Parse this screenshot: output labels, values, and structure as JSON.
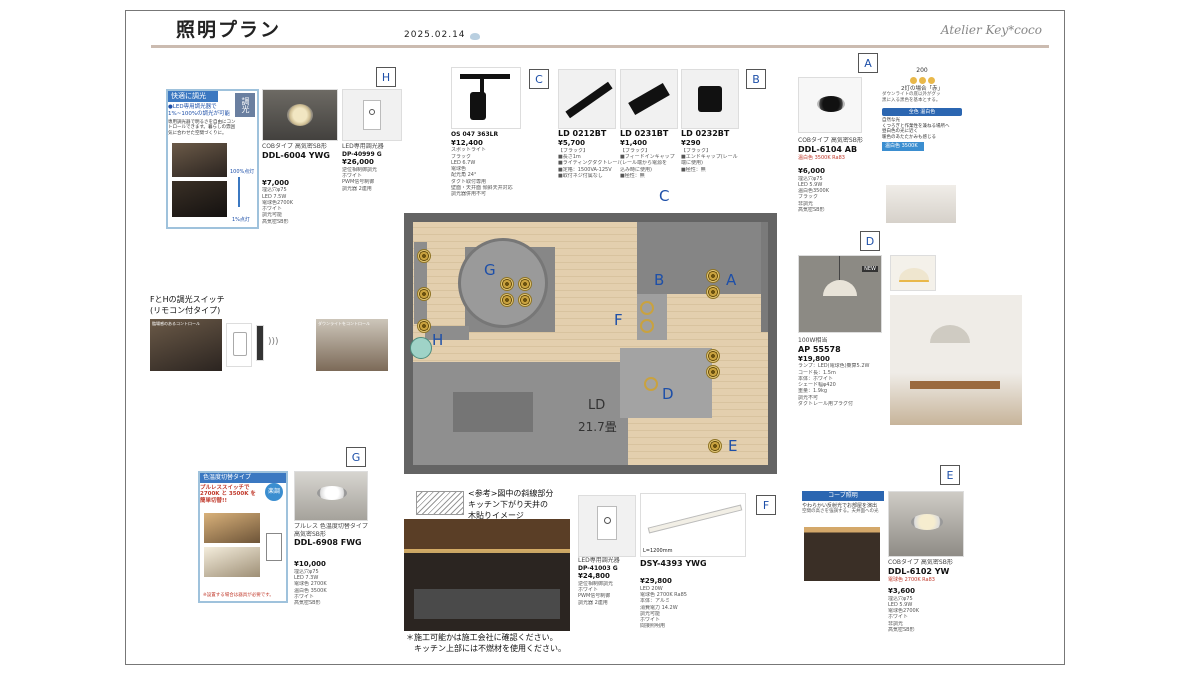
{
  "header": {
    "title": "照明プラン",
    "date": "2025.02.14",
    "brand": "Atelier Key*coco"
  },
  "tags": {
    "H": "H",
    "C": "C",
    "B": "B",
    "A": "A",
    "D": "D",
    "G": "G",
    "F": "F",
    "E": "E"
  },
  "cards": {
    "h_info": {
      "head": "快適に調光",
      "body": "●LED専用調光器で\n1%~100%の調光が可能",
      "body2": "専用調光器で明るさを自由にコントロールできます。暮らしの雰囲気に合わせた空間づくりに。",
      "pct_top": "100%点灯",
      "pct_bottom": "1%点灯",
      "badge": "調光"
    },
    "h_main": {
      "sub": "COBタイプ 高気密SB形",
      "model": "DDL-6004 YWG",
      "price": "¥7,000",
      "lines": [
        "埋込穴φ75",
        "LED 7.5W",
        "電球色2700K",
        "ホワイト",
        "調光可能",
        "高気密SB形"
      ]
    },
    "h_switch": {
      "sub": "LED専用調光器",
      "model": "DP-40999 G",
      "price": "¥26,000",
      "lines": [
        "逆位相制御調光",
        "ホワイト",
        "PWM信号制御",
        "調光器 2連用"
      ]
    },
    "c_card": {
      "model": "OS 047 363LR",
      "price": "¥12,400",
      "lines": [
        "スポットライト",
        "ブラック",
        "LED 6.7W",
        "電球色",
        "配光角 24°",
        "ダクト取付専用",
        "壁面・天井面 傾斜天井対応",
        "調光器併用不可"
      ]
    },
    "b1": {
      "model": "LD 0212BT",
      "price": "¥5,700",
      "lines": [
        "【ブラック】",
        "■長さ1m",
        "■ライティングダクトレール",
        "■定格：1500VA-125V",
        "■取付ネジ付属なし"
      ]
    },
    "b2": {
      "model": "LD 0231BT",
      "price": "¥1,400",
      "lines": [
        "【ブラック】",
        "■フィードインキャップ",
        "(レール端から電源を",
        "込み時に使用)",
        "■極性：無"
      ]
    },
    "b3": {
      "model": "LD 0232BT",
      "price": "¥290",
      "lines": [
        "【ブラック】",
        "■エンドキャップ(レール",
        "端に使用)",
        "■極性：無"
      ]
    },
    "a_card": {
      "sub": "COBタイプ 高気密SB形",
      "model": "DDL-6104 AB",
      "sub2": "温白色 3500K Ra83",
      "price": "¥6,000",
      "lines": [
        "埋込穴φ75",
        "LED 5.9W",
        "温白色3500K",
        "ブラック",
        "非調光",
        "高気密SB形"
      ]
    },
    "a_right": {
      "count": "200",
      "case": "2灯の場合「赤」",
      "desc": "ダウンライトの底以外がグッ\n黒に入る黒色を基本とする。",
      "pill1": "全色",
      "pill2": "温白色",
      "pill_text": "自然な光\nくつろぎと作業性を兼ねる場所へ",
      "pill_text2": "昼白色の光に近く\n暖色のあたたかみも感じる",
      "pill3": "温白色 3500K"
    },
    "d_card": {
      "badge": "NEW",
      "sub": "100W相当",
      "model": "AP 55578",
      "price": "¥19,800",
      "lines": [
        "ランプ：LED(電球色)乗算5.2W",
        "コード長：1.5m",
        "本体：ホワイト",
        "シェード幅φ420",
        "重量：1.9kg",
        "調光不可",
        "ダクトレール用プラグ付"
      ]
    },
    "fh_note": {
      "text": "FとHの調光スイッチ\n(リモコン付タイプ)",
      "labels": [
        "臨場感のあるコントロール",
        "ダウンライトをコントロール"
      ]
    },
    "g_info": {
      "head": "色温度切替タイプ",
      "body": "プルレススイッチで\n2700K と 3500K を\n簡単切替!!",
      "badge": "楽調",
      "foot": "※設置する場合は器具が必要です。"
    },
    "g_card": {
      "sub": "プルレス 色温度切替タイプ 高気密SB形",
      "model": "DDL-6908 FWG",
      "price": "¥10,000",
      "lines": [
        "埋込穴φ75",
        "LED 7.3W",
        "電球色 2700K",
        "温白色 3500K",
        "ホワイト",
        "高気密SB形"
      ]
    },
    "g_note": {
      "text": "<参考>図中の斜線部分\nキッチン下がり天井の\n木貼りイメージ"
    },
    "f_switch": {
      "sub": "LED専用調光器",
      "model": "DP-41003 G",
      "price": "¥24,800",
      "lines": [
        "逆位相制御調光",
        "ホワイト",
        "PWM信号制御",
        "調光器 2連用"
      ]
    },
    "f_card": {
      "model": "DSY-4393 YWG",
      "price": "¥29,800",
      "sub": "L=1200mm",
      "lines": [
        "LED 20W",
        "電球色 2700K Ra85",
        "本体：アルミ",
        "消費電力 14.2W",
        "調光可能",
        "ホワイト",
        "間接照明用"
      ]
    },
    "e_info": {
      "head": "コーブ照明",
      "body": "やわらかい反射光でお部屋を演出",
      "body2": "空間の高さを強調する。天井面への光"
    },
    "e_card": {
      "sub": "COBタイプ 高気密SB形",
      "model": "DDL-6102 YW",
      "sub2": "電球色 2700K Ra83",
      "price": "¥3,600",
      "lines": [
        "埋込穴φ75",
        "LED 5.9W",
        "電球色2700K",
        "ホワイト",
        "非調光",
        "高気密SB形"
      ]
    },
    "bottom_note": {
      "text": "＊施工可能かは施工会社に確認ください。\n　キッチン上部には不燃材を使用ください。"
    }
  },
  "plan": {
    "label_ld": "LD",
    "label_area": "21.7畳",
    "c_label": "C"
  }
}
